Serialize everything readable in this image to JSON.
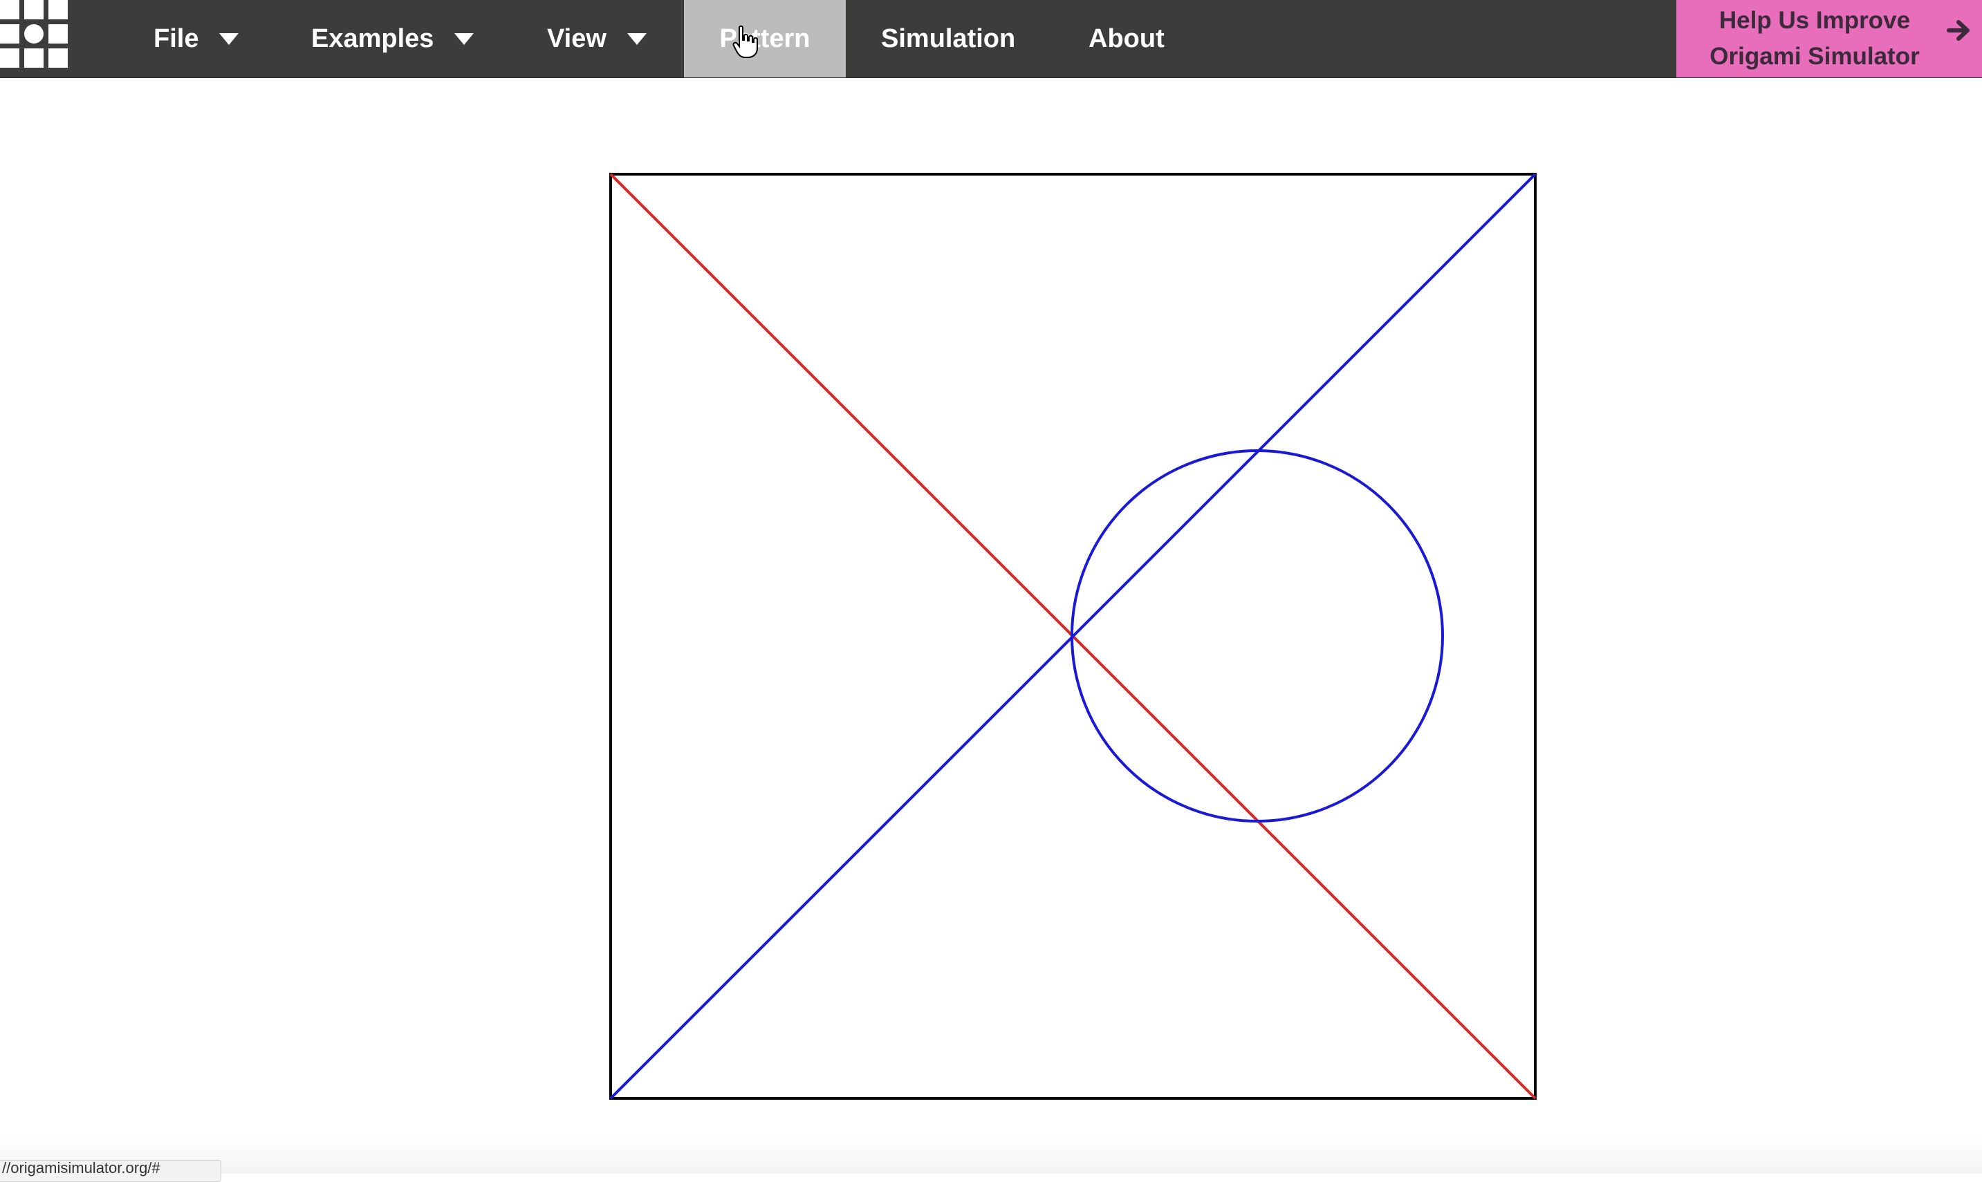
{
  "nav": {
    "logo_icon": "origami-grid-logo-icon",
    "file_label": "File",
    "examples_label": "Examples",
    "view_label": "View",
    "pattern_label": "Pattern",
    "simulation_label": "Simulation",
    "about_label": "About",
    "active_tab": "Pattern"
  },
  "help_button": {
    "line1": "Help Us Improve",
    "line2": "Origami Simulator",
    "icon": "arrow-right-icon",
    "color": "#e86dbb"
  },
  "crease_pattern": {
    "border_color": "#000000",
    "mountain_color": "#d12a2a",
    "valley_color": "#1a1ad6"
  },
  "status_bar": {
    "url_text": "//origamisimulator.org/#"
  },
  "colors": {
    "navbar_bg": "#3c3c3b",
    "active_tab_bg": "#bcbcbc"
  }
}
